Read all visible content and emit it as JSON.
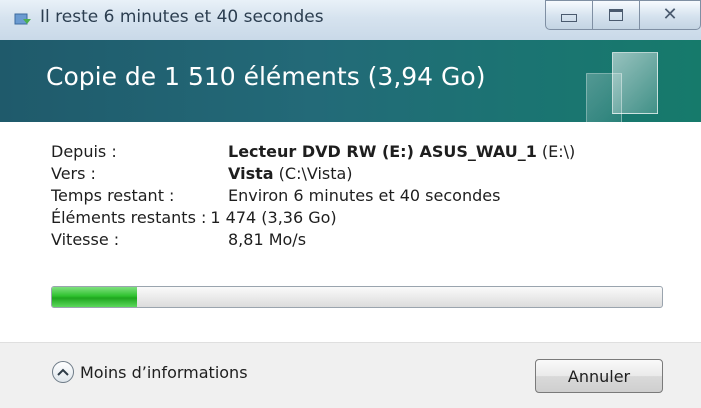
{
  "window": {
    "title": "Il reste 6 minutes et 40 secondes",
    "buttons": {
      "minimize_icon": "minimize-icon",
      "maximize_icon": "maximize-icon",
      "close_icon": "close-icon"
    }
  },
  "banner": {
    "title": "Copie de 1 510 éléments (3,94 Go)",
    "accent_color": "#1f6a75"
  },
  "details": {
    "from": {
      "label": "Depuis :",
      "value_bold": "Lecteur DVD RW (E:) ASUS_WAU_1",
      "value_extra": " (E:\\)"
    },
    "to": {
      "label": "Vers :",
      "value_bold": "Vista",
      "value_extra": " (C:\\Vista)"
    },
    "time_left": {
      "label": "Temps restant :",
      "value": "Environ 6 minutes et 40 secondes"
    },
    "items_left": {
      "label": "Éléments restants :",
      "value": "1 474 (3,36 Go)"
    },
    "speed": {
      "label": "Vitesse :",
      "value": "8,81 Mo/s"
    }
  },
  "progress": {
    "fraction": 0.14,
    "color": "#2fc22f"
  },
  "footer": {
    "more_info_label": "Moins d’informations",
    "cancel_label": "Annuler"
  }
}
